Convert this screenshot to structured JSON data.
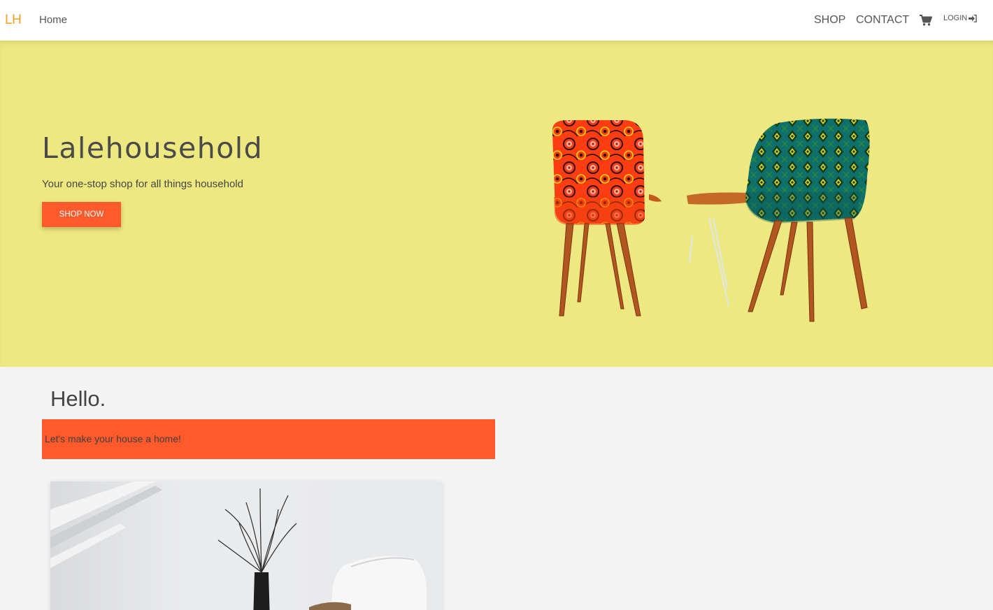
{
  "nav": {
    "brand": "LH",
    "home": "Home",
    "shop": "SHOP",
    "contact": "CONTACT",
    "cart_icon": "shopping-cart-icon",
    "login": "LOGIN",
    "login_icon": "sign-in-icon"
  },
  "hero": {
    "title": "Lalehousehold",
    "tagline": "Your one-stop shop for all things household",
    "cta": "SHOP NOW",
    "background_color": "#ede980",
    "accent_color": "#ff5a2c"
  },
  "main": {
    "greeting": "Hello.",
    "banner_text": "Let's make your house a home!"
  }
}
